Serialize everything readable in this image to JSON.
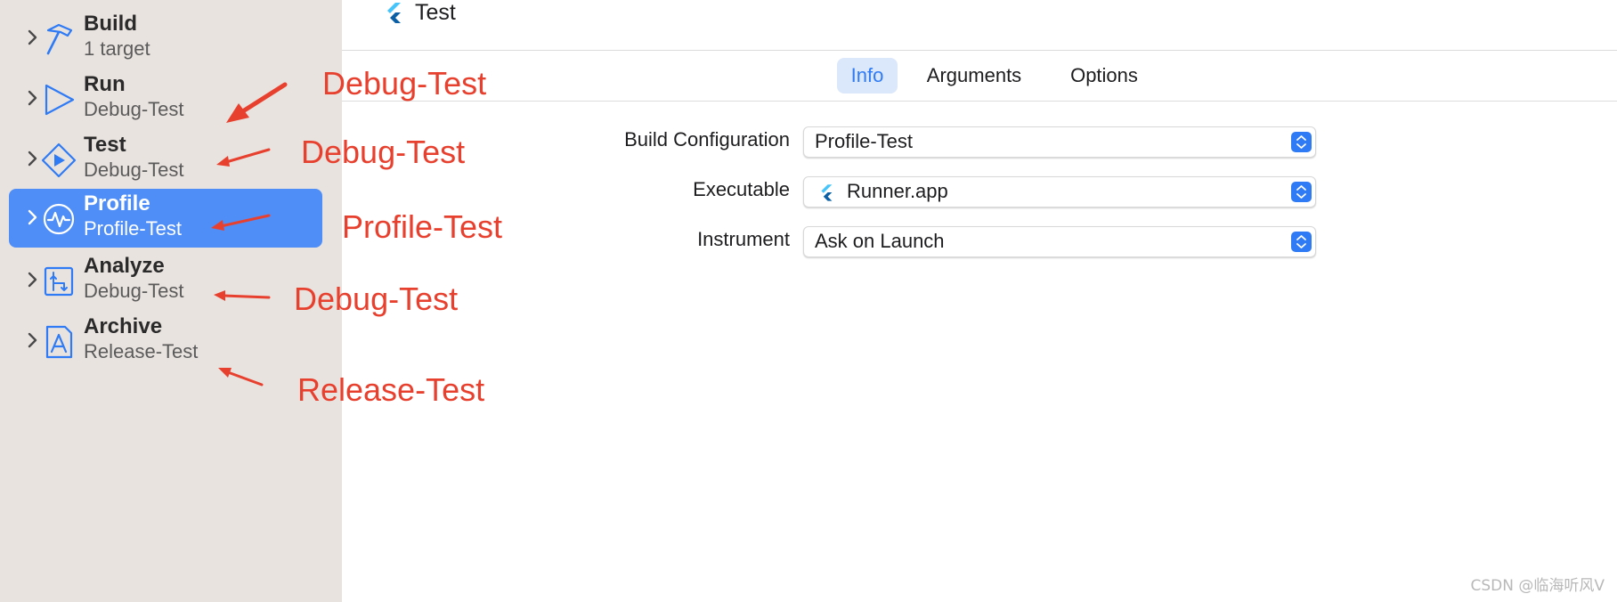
{
  "sidebar": {
    "items": [
      {
        "title": "Build",
        "subtitle": "1 target",
        "icon": "hammer-icon",
        "selected": false
      },
      {
        "title": "Run",
        "subtitle": "Debug-Test",
        "icon": "play-icon",
        "selected": false
      },
      {
        "title": "Test",
        "subtitle": "Debug-Test",
        "icon": "test-diamond-icon",
        "selected": false
      },
      {
        "title": "Profile",
        "subtitle": "Profile-Test",
        "icon": "waveform-icon",
        "selected": true
      },
      {
        "title": "Analyze",
        "subtitle": "Debug-Test",
        "icon": "analyze-icon",
        "selected": false
      },
      {
        "title": "Archive",
        "subtitle": "Release-Test",
        "icon": "archive-app-icon",
        "selected": false
      }
    ]
  },
  "header": {
    "title": "Test",
    "icon": "flutter-icon"
  },
  "tabs": [
    {
      "label": "Info",
      "active": true
    },
    {
      "label": "Arguments",
      "active": false
    },
    {
      "label": "Options",
      "active": false
    }
  ],
  "form": {
    "build_configuration": {
      "label": "Build Configuration",
      "value": "Profile-Test"
    },
    "executable": {
      "label": "Executable",
      "value": "Runner.app",
      "icon": "flutter-icon"
    },
    "instrument": {
      "label": "Instrument",
      "value": "Ask on Launch"
    }
  },
  "annotations": [
    "Debug-Test",
    "Debug-Test",
    "Profile-Test",
    "Debug-Test",
    "Release-Test"
  ],
  "watermark": "CSDN @临海听风V",
  "colors": {
    "sidebar_bg": "#e9e3df",
    "selection": "#4f8ef7",
    "accent": "#2f7bf5",
    "annotation": "#e8402e"
  }
}
